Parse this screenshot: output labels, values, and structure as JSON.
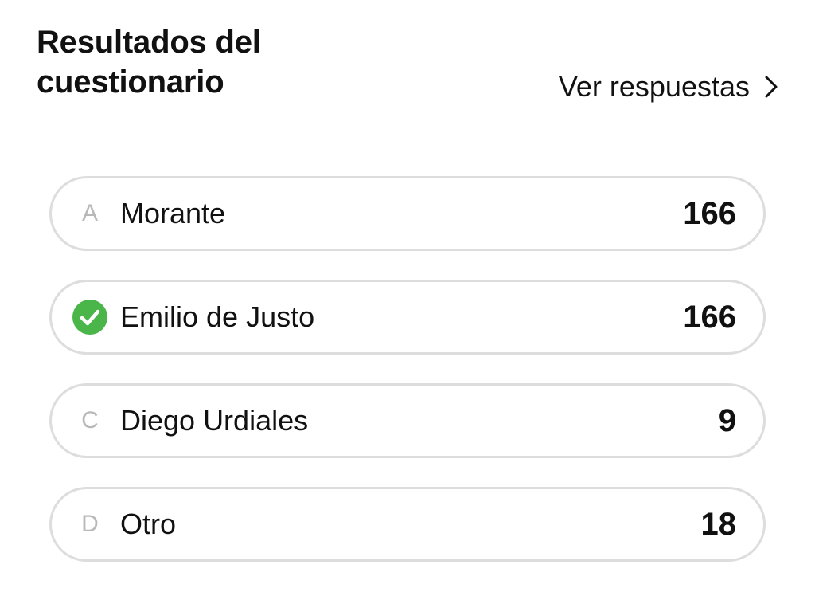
{
  "header": {
    "title": "Resultados del cuestionario",
    "view_answers_label": "Ver respuestas",
    "view_answers_icon": "chevron-right-icon"
  },
  "options": [
    {
      "letter": "A",
      "label": "Morante",
      "count": "166",
      "correct": false
    },
    {
      "letter": "",
      "label": "Emilio de Justo",
      "count": "166",
      "correct": true,
      "icon": "check-circle-icon",
      "icon_color": "#4ab548"
    },
    {
      "letter": "C",
      "label": "Diego Urdiales",
      "count": "9",
      "correct": false
    },
    {
      "letter": "D",
      "label": "Otro",
      "count": "18",
      "correct": false
    }
  ],
  "colors": {
    "text": "#111111",
    "letter": "#b8b8b8",
    "border": "#dddddd",
    "correct": "#4ab548"
  }
}
